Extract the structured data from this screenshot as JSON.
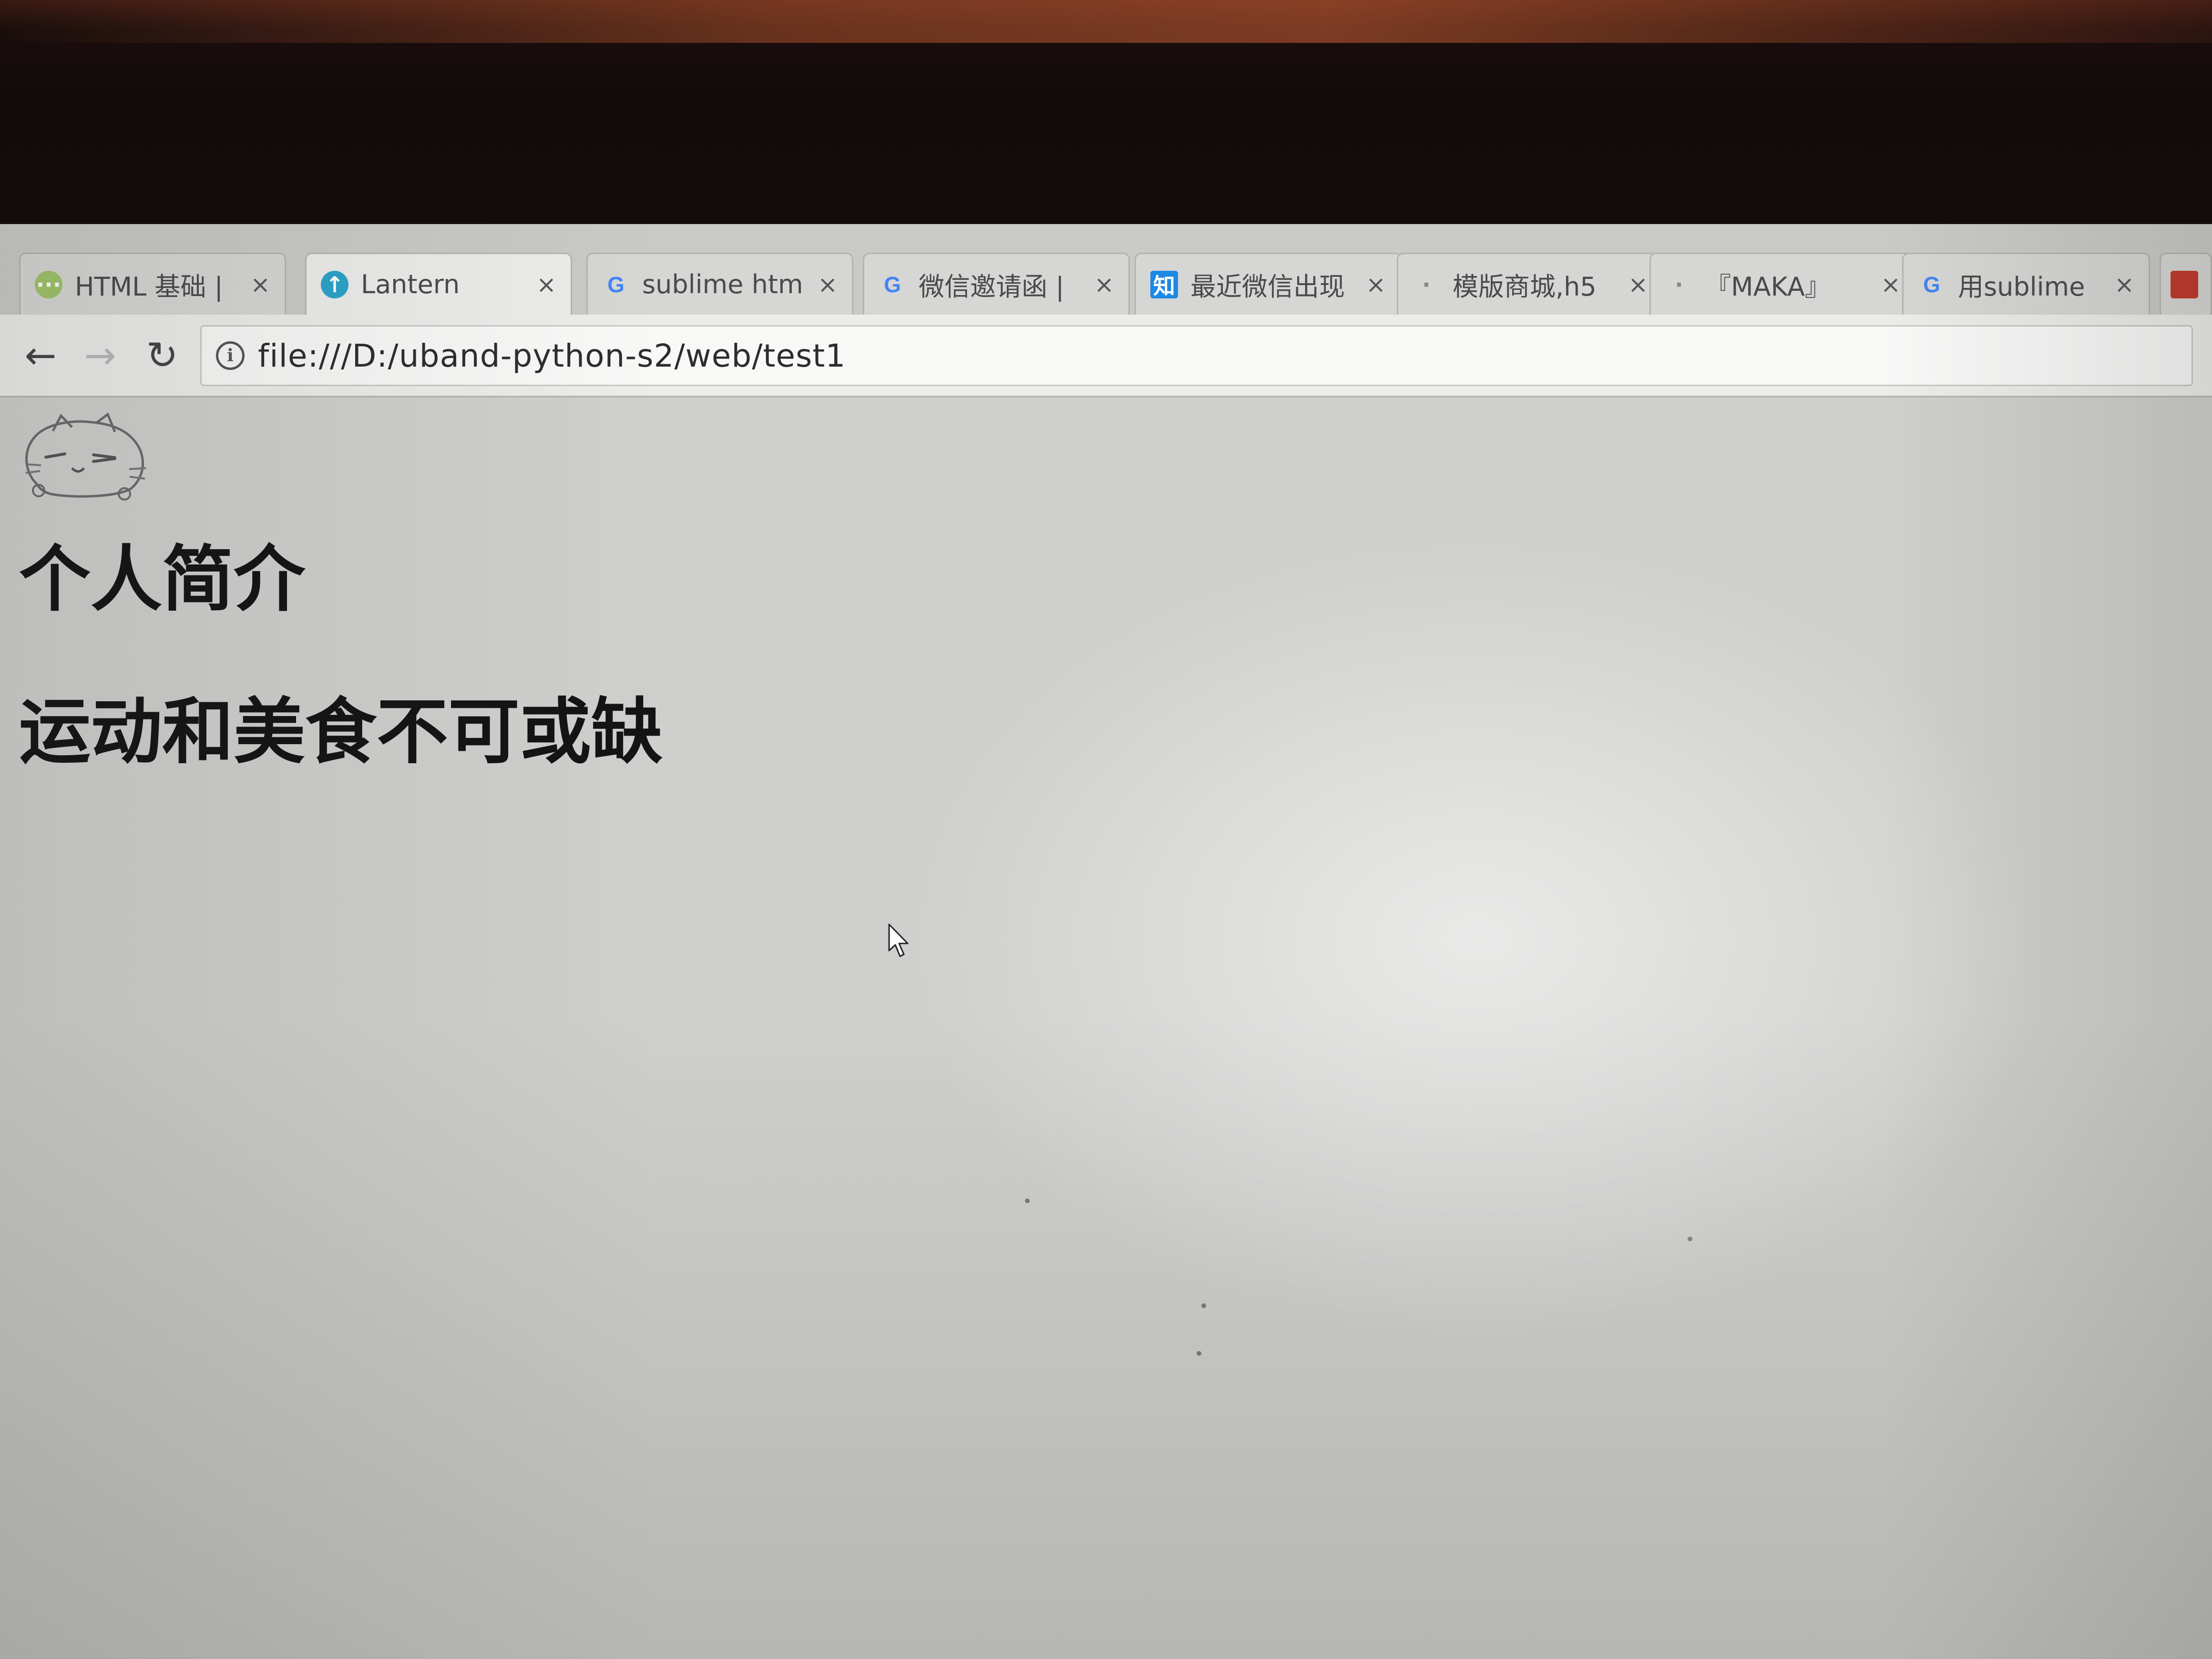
{
  "browser": {
    "tabs": [
      {
        "favicon": "html-course-icon",
        "title": "HTML 基础 |",
        "active": false
      },
      {
        "favicon": "lantern-icon",
        "title": "Lantern",
        "active": true
      },
      {
        "favicon": "google-icon",
        "title": "sublime htm",
        "active": false
      },
      {
        "favicon": "google-icon",
        "title": "微信邀请函 |",
        "active": false
      },
      {
        "favicon": "zhihu-icon",
        "title": "最近微信出现",
        "active": false
      },
      {
        "favicon": "dot-icon",
        "title": "模版商城,h5",
        "active": false
      },
      {
        "favicon": "dot-icon",
        "title": "『MAKA』 ",
        "active": false
      },
      {
        "favicon": "google-icon",
        "title": "用sublime",
        "active": false
      }
    ],
    "tab_close_glyph": "×",
    "favicon_glyphs": {
      "google": "G",
      "zhihu": "知",
      "lantern": "↑",
      "html": "···",
      "dot": "·"
    },
    "nav": {
      "back_glyph": "←",
      "forward_glyph": "→",
      "reload_glyph": "↻"
    },
    "address_bar": {
      "info_glyph": "i",
      "url": "file:///D:/uband-python-s2/web/test1"
    }
  },
  "page": {
    "avatar": "cat-face-sketch",
    "heading_1": "个人简介",
    "heading_2": "运动和美食不可或缺"
  },
  "colors": {
    "screen_bg": "#cfcfcd",
    "tab_bg": "#d6d6d4",
    "toolbar_bg": "#ececea",
    "heading_text": "#141414"
  }
}
